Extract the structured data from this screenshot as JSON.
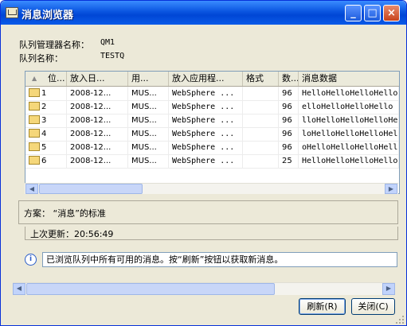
{
  "window": {
    "title": "消息浏览器"
  },
  "titlebar": {
    "minimize_glyph": "_",
    "maximize_glyph": "□",
    "close_glyph": "×"
  },
  "info": {
    "qmgr_label": "队列管理器名称：",
    "qmgr_value": "QM1",
    "queue_label": "队列名称：",
    "queue_value": "TESTQ"
  },
  "table": {
    "columns": [
      "位...",
      "放入日...",
      "用...",
      "放入应用程...",
      "格式",
      "数...",
      "消息数据"
    ],
    "rows": [
      [
        "1",
        "2008-12...",
        "MUS...",
        "WebSphere ...",
        "",
        "96",
        "HelloHelloHelloHello"
      ],
      [
        "2",
        "2008-12...",
        "MUS...",
        "WebSphere ...",
        "",
        "96",
        "elloHelloHelloHello"
      ],
      [
        "3",
        "2008-12...",
        "MUS...",
        "WebSphere ...",
        "",
        "96",
        "lloHelloHelloHelloHe"
      ],
      [
        "4",
        "2008-12...",
        "MUS...",
        "WebSphere ...",
        "",
        "96",
        "loHelloHelloHelloHel"
      ],
      [
        "5",
        "2008-12...",
        "MUS...",
        "WebSphere ...",
        "",
        "96",
        "oHelloHelloHelloHell"
      ],
      [
        "6",
        "2008-12...",
        "MUS...",
        "WebSphere ...",
        "",
        "25",
        "HelloHelloHelloHello"
      ]
    ]
  },
  "scheme": {
    "text": "方案：  “消息”的标准"
  },
  "last_update": {
    "text": "上次更新：20:56:49"
  },
  "status": {
    "message": "已浏览队列中所有可用的消息。按“刷新”按钮以获取新消息。"
  },
  "buttons": {
    "refresh": "刷新(R)",
    "close": "关闭(C)"
  }
}
